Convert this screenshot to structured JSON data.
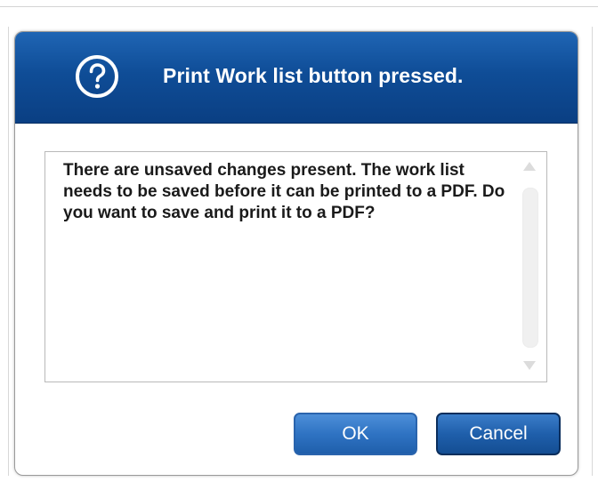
{
  "dialog": {
    "title": "Print Work list button pressed.",
    "icon": "question-icon",
    "message": "There are unsaved changes present. The work list needs to be saved before it can be printed to a PDF. Do you want to save and print it to a PDF?",
    "ok_label": "OK",
    "cancel_label": "Cancel"
  },
  "colors": {
    "header_top": "#1f65b4",
    "header_bottom": "#0a3f83",
    "button_blue": "#2f73c3",
    "text": "#1a1a1a"
  }
}
